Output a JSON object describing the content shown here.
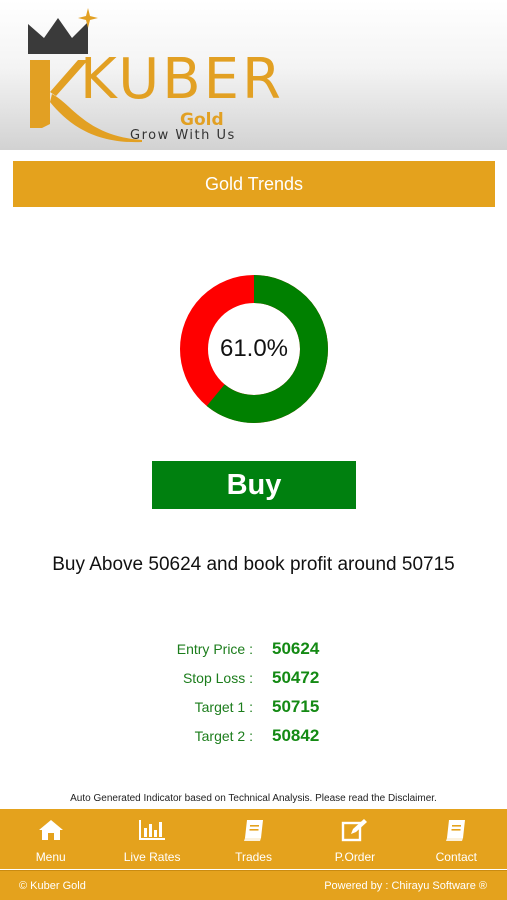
{
  "brand": {
    "word": "KUBER",
    "sub": "Gold",
    "tagline": "Grow With Us"
  },
  "page_title": "Gold Trends",
  "gauge": {
    "percent": 61.0,
    "label": "61.0%",
    "colors": {
      "primary": "#008000",
      "remainder": "#FF0000"
    }
  },
  "action_label": "Buy",
  "advice": "Buy Above 50624 and book profit around 50715",
  "levels": [
    {
      "label": "Entry Price :",
      "value": "50624"
    },
    {
      "label": "Stop Loss :",
      "value": "50472"
    },
    {
      "label": "Target 1 :",
      "value": "50715"
    },
    {
      "label": "Target 2 :",
      "value": "50842"
    }
  ],
  "disclaimer": "Auto Generated Indicator based on Technical Analysis. Please read the Disclaimer.",
  "nav": [
    {
      "label": "Menu",
      "icon": "home-icon"
    },
    {
      "label": "Live Rates",
      "icon": "bar-chart-icon"
    },
    {
      "label": "Trades",
      "icon": "book-icon"
    },
    {
      "label": "P.Order",
      "icon": "edit-icon"
    },
    {
      "label": "Contact",
      "icon": "book-icon"
    }
  ],
  "footer": {
    "copyright": "© Kuber Gold",
    "powered": "Powered by : Chirayu Software ®"
  },
  "theme": {
    "accent": "#E4A21D",
    "buy_green": "#00800F",
    "value_green": "#148A14"
  }
}
